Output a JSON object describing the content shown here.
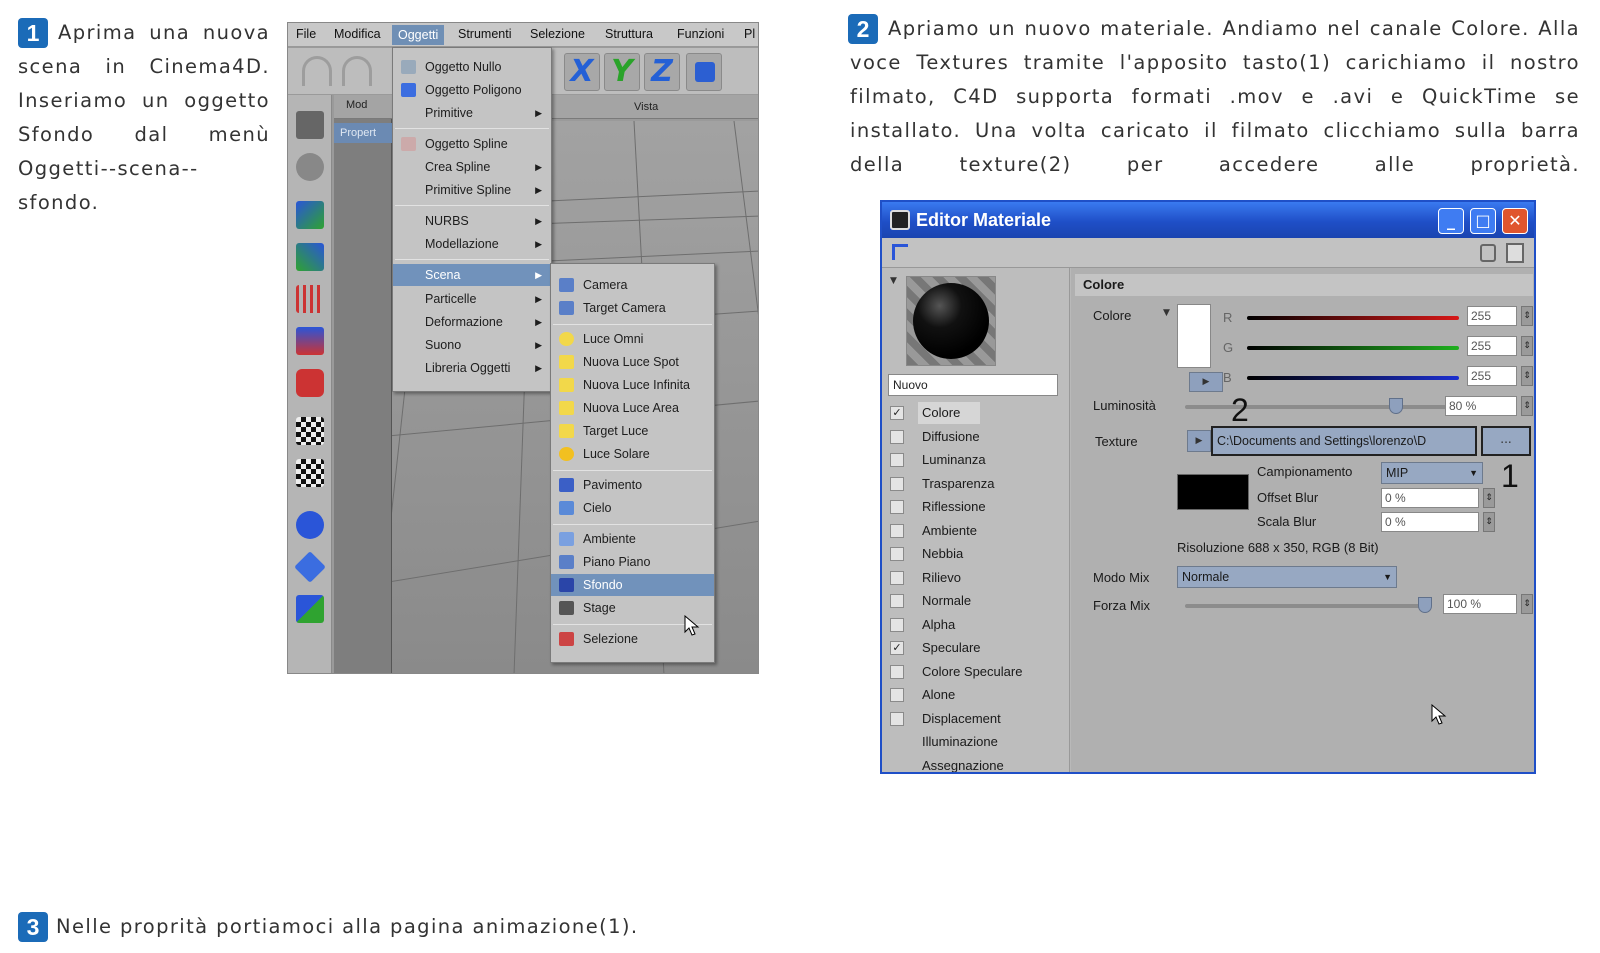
{
  "step1": {
    "number": "1",
    "text": "Aprima una nuova scena in Cinema4D. Inseriamo un oggetto Sfondo dal menù Oggetti--scena--sfondo."
  },
  "step2": {
    "number": "2",
    "text": "Apriamo un nuovo materiale. Andiamo nel canale Colore. Alla voce Textures tramite l'apposito tasto(1) carichiamo il nostro filmato, C4D supporta formati .mov e .avi e QuickTime se installato. Una volta caricato il filmato clicchiamo sulla barra della texture(2) per accedere alle proprietà."
  },
  "step3": {
    "number": "3",
    "text": "Nelle proprità portiamoci alla pagina animazione(1)."
  },
  "c4d": {
    "menubar": [
      "File",
      "Modifica",
      "Oggetti",
      "Strumenti",
      "Selezione",
      "Struttura",
      "Funzioni",
      "Pl"
    ],
    "viewport_label": "Mod",
    "viewport_side_label": "Propert",
    "viewport_title": "Vista",
    "axis_buttons": [
      "X",
      "Y",
      "Z"
    ],
    "oggetti_menu": [
      {
        "label": "Oggetto Nullo",
        "arrow": false
      },
      {
        "label": "Oggetto Poligono",
        "arrow": false
      },
      {
        "label": "Primitive",
        "arrow": true
      },
      {
        "label": "Oggetto Spline",
        "arrow": false
      },
      {
        "label": "Crea Spline",
        "arrow": true
      },
      {
        "label": "Primitive Spline",
        "arrow": true
      },
      {
        "label": "NURBS",
        "arrow": true
      },
      {
        "label": "Modellazione",
        "arrow": true
      },
      {
        "label": "Scena",
        "arrow": true
      },
      {
        "label": "Particelle",
        "arrow": true
      },
      {
        "label": "Deformazione",
        "arrow": true
      },
      {
        "label": "Suono",
        "arrow": true
      },
      {
        "label": "Libreria Oggetti",
        "arrow": true
      }
    ],
    "scena_menu": [
      "Camera",
      "Target Camera",
      "Luce Omni",
      "Nuova Luce Spot",
      "Nuova Luce Infinita",
      "Nuova Luce Area",
      "Target Luce",
      "Luce Solare",
      "Pavimento",
      "Cielo",
      "Ambiente",
      "Piano Piano",
      "Sfondo",
      "Stage",
      "Selezione"
    ]
  },
  "editor": {
    "title": "Editor Materiale",
    "material_name": "Nuovo",
    "channels": [
      {
        "label": "Colore",
        "checked": true,
        "selected": true
      },
      {
        "label": "Diffusione",
        "checked": false
      },
      {
        "label": "Luminanza",
        "checked": false
      },
      {
        "label": "Trasparenza",
        "checked": false
      },
      {
        "label": "Riflessione",
        "checked": false
      },
      {
        "label": "Ambiente",
        "checked": false
      },
      {
        "label": "Nebbia",
        "checked": false
      },
      {
        "label": "Rilievo",
        "checked": false
      },
      {
        "label": "Normale",
        "checked": false
      },
      {
        "label": "Alpha",
        "checked": false
      },
      {
        "label": "Speculare",
        "checked": true
      },
      {
        "label": "Colore Speculare",
        "checked": false
      },
      {
        "label": "Alone",
        "checked": false
      },
      {
        "label": "Displacement",
        "checked": false
      },
      {
        "label": "Illuminazione",
        "checked": null
      },
      {
        "label": "Assegnazione",
        "checked": null
      }
    ],
    "section_title": "Colore",
    "color_label": "Colore",
    "r_label": "R",
    "g_label": "G",
    "b_label": "B",
    "r_value": "255",
    "g_value": "255",
    "b_value": "255",
    "luminosity_label": "Luminosità",
    "luminosity_value": "80 %",
    "luminosity_level": 0.8,
    "texture_label": "Texture",
    "texture_path": "C:\\Documents and Settings\\lorenzo\\D",
    "texture_button": "...",
    "annotation_1": "1",
    "annotation_2": "2",
    "campionamento_label": "Campionamento",
    "campionamento_value": "MIP",
    "offset_blur_label": "Offset Blur",
    "offset_blur_value": "0 %",
    "scala_blur_label": "Scala Blur",
    "scala_blur_value": "0 %",
    "resolution_text": "Risoluzione 688 x 350, RGB (8 Bit)",
    "mix_mode_label": "Modo Mix",
    "mix_mode_value": "Normale",
    "mix_strength_label": "Forza Mix",
    "mix_strength_value": "100 %",
    "mix_strength_level": 1.0,
    "colors": {
      "red": "#d81818",
      "green": "#1fb01f",
      "blue": "#1c2fd0",
      "titlebar": "#1f4fc7",
      "accent": "#1b6bb8"
    }
  }
}
